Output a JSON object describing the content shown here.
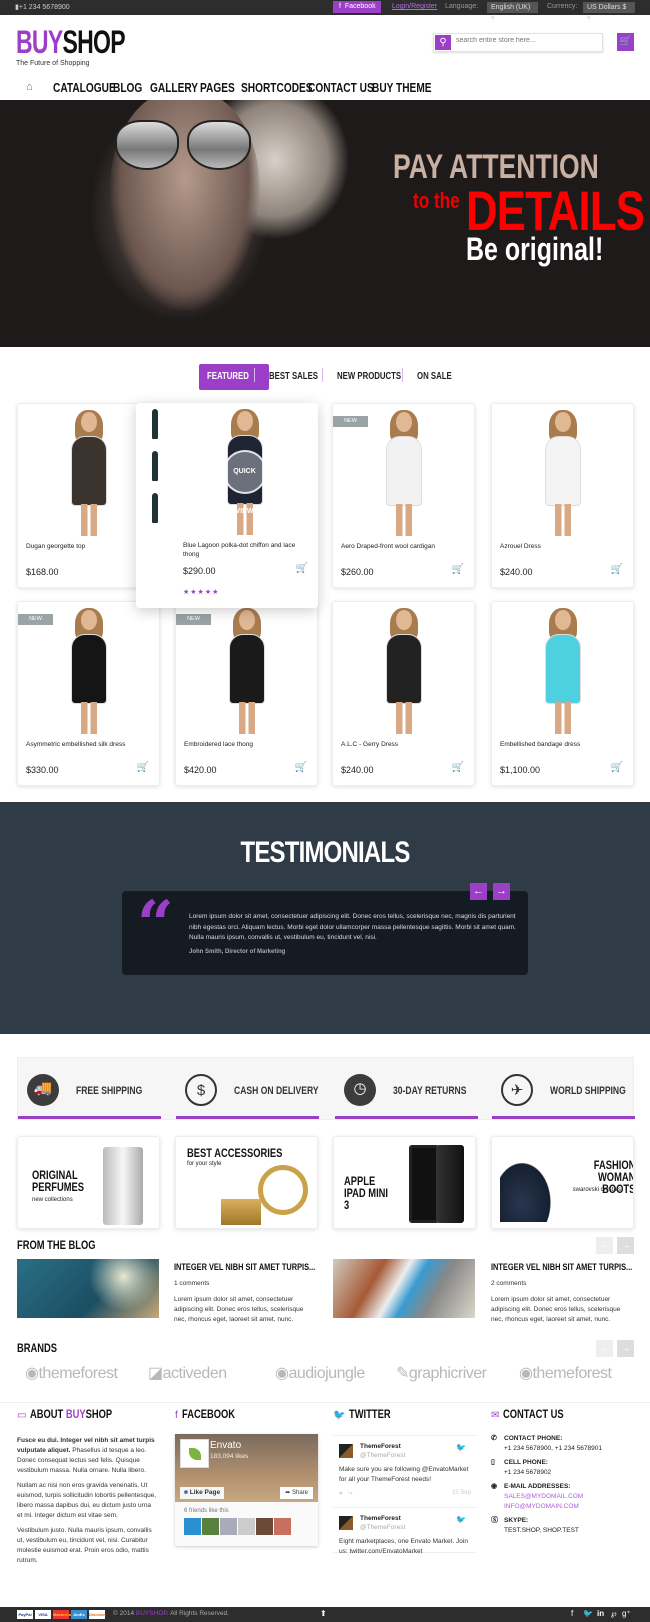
{
  "topbar": {
    "phone": "+1 234 5678900",
    "facebook": "Facebook",
    "login": "Login",
    "register": "Register",
    "language_label": "Language:",
    "language": "English (UK)",
    "currency_label": "Currency:",
    "currency": "US Dollars $"
  },
  "header": {
    "logo_buy": "BUY",
    "logo_shop": "SHOP",
    "tagline": "The Future of Shopping",
    "search_placeholder": "search entire store here..."
  },
  "nav": [
    "CATALOGUE",
    "BLOG",
    "GALLERY",
    "PAGES",
    "SHORTCODES",
    "CONTACT US",
    "BUY THEME"
  ],
  "hero": {
    "line1": "PAY ATTENTION",
    "line2": "to the",
    "line3": "DETAILS",
    "line4": "Be original!"
  },
  "tabs": [
    "FEATURED",
    "BEST SALES",
    "NEW PRODUCTS",
    "ON SALE"
  ],
  "products": [
    {
      "name": "Dugan georgette top",
      "price": "$168.00",
      "dress": "#3b342e"
    },
    {
      "name": "Blue Lagoon polka-dot chiffon and lace thong",
      "price": "$290.00",
      "dress": "#1e2433",
      "quick_view": "QUICK VIEW",
      "rating": "★★★★★"
    },
    {
      "name": "Aero Draped-front wool cardigan",
      "price": "$260.00",
      "badge": "NEW",
      "dress": "#f2f2f2"
    },
    {
      "name": "Azrouel Dress",
      "price": "$240.00",
      "dress": "#f4f4f4"
    },
    {
      "name": "Asymmetric embellished silk dress",
      "price": "$330.00",
      "badge": "NEW",
      "dress": "#151515"
    },
    {
      "name": "Embroidered lace thong",
      "price": "$420.00",
      "badge": "NEW",
      "dress": "#1a1a1a"
    },
    {
      "name": "A.L.C - Gerry Dress",
      "price": "$240.00",
      "dress": "#222"
    },
    {
      "name": "Embellished bandage dress",
      "price": "$1,100.00",
      "dress": "#4fd0e0"
    }
  ],
  "testimonials": {
    "title": "TESTIMONIALS",
    "text": "Lorem ipsum dolor sit amet, consectetuer adipiscing elit. Donec eros tellus, scelerisque nec, magnis dis parturient nibh egestas orci. Aliquam lectus. Morbi eget dolor ullamcorper massa pellentesque sagittis. Morbi sit amet quam. Nulla mauris ipsum, convallis ut, vestibulum eu, tincidunt vel, nisi.",
    "author": "John Smith, Director of Marketing"
  },
  "services": [
    "FREE SHIPPING",
    "CASH ON DELIVERY",
    "30-DAY RETURNS",
    "WORLD SHIPPING"
  ],
  "banners": [
    {
      "title": "ORIGINAL PERFUMES",
      "sub": "new collections"
    },
    {
      "title": "BEST ACCESSORIES",
      "sub": "for your style"
    },
    {
      "title": "APPLE IPAD MINI 3"
    },
    {
      "title": "FASHION WOMAN BOOTS",
      "sub": "swarovski crystals"
    }
  ],
  "blog": {
    "title": "FROM THE BLOG",
    "posts": [
      {
        "title": "INTEGER VEL NIBH SIT AMET TURPIS...",
        "comments": "1 comments",
        "text": "Lorem ipsum dolor sit amet, consectetuer adipiscing elit. Donec eros tellus, scelerisque nec, rhoncus eget, laoreet sit amet, nunc."
      },
      {
        "title": "INTEGER VEL NIBH SIT AMET TURPIS...",
        "comments": "2 comments",
        "text": "Lorem ipsum dolor sit amet, consectetuer adipiscing elit. Donec eros tellus, scelerisque nec, rhoncus eget, laoreet sit amet, nunc."
      }
    ]
  },
  "brands": {
    "title": "BRANDS",
    "items": [
      "themeforest",
      "activeden",
      "audiojungle",
      "graphicriver",
      "themeforest"
    ]
  },
  "footer": {
    "about": {
      "title_pre": "ABOUT ",
      "title_buy": "BUY",
      "title_shop": "SHOP",
      "p1_bold": "Fusce eu dui. Integer vel nibh sit amet turpis vulputate aliquet.",
      "p1": " Phasellus id tesque a leo. Donec consequat lectus sed felis. Quisque vestibulum massa. Nulla ornare. Nulla libero.",
      "p2": "Nullam ac nisi non eros gravida venenatis. Ut euismod, turpis sollicitudin lobortis pellentesque, libero massa dapibus dui, eu dictum justo urna et mi. Integer dictum est vitae sem.",
      "p3": "Vestibulum justo. Nulla mauris ipsum, convallis ut, vestibulum eu, tincidunt vel, nisi. Curabitur molestie euismod erat. Proin eros odio, mattis rutrum."
    },
    "facebook": {
      "title": "FACEBOOK",
      "page": "Envato",
      "likes": "183,094 likes",
      "like_btn": "Like Page",
      "share_btn": "Share",
      "friends": "6 friends like this"
    },
    "twitter": {
      "title": "TWITTER",
      "tweets": [
        {
          "name": "ThemeForest",
          "handle": "@ThemeForest",
          "text": "Make sure you are following @EnvatoMarket for all your ThemeForest needs!",
          "date": "15 Sep"
        },
        {
          "name": "ThemeForest",
          "handle": "@ThemeForest",
          "text": "Eight marketplaces, one Envato Market. Join us: twitter.com/EnvatoMarket"
        }
      ]
    },
    "contact": {
      "title": "CONTACT US",
      "phone_label": "CONTACT PHONE:",
      "phone": "+1 234 5678900, +1 234 5678901",
      "cell_label": "CELL PHONE:",
      "cell": "+1 234 5678902",
      "email_label": "E-MAIL ADDRESSES:",
      "email1": "SALES@MYDOMAIL.COM",
      "email2": "INFO@MYDOMAIN.COM",
      "skype_label": "SKYPE:",
      "skype": "TEST.SHOP, SHOP.TEST"
    }
  },
  "bottom": {
    "payments": [
      "PayPal",
      "VISA",
      "MasterCard",
      "AmEx",
      "Discover"
    ],
    "copy_pre": "© 2014 ",
    "copy_brand": "BUYSHOP",
    "copy_post": ". All Rights Reserved."
  },
  "colors": {
    "accent": "#9b3fc8",
    "dark": "#2d2d2d",
    "testimonials_bg": "#2f3b47"
  }
}
